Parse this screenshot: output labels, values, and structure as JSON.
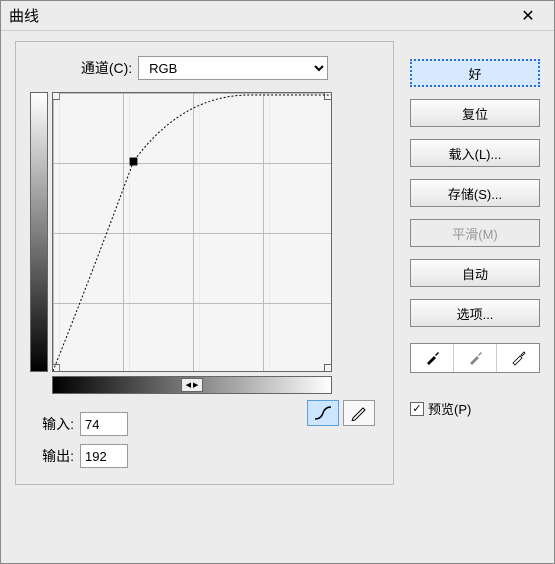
{
  "window": {
    "title": "曲线"
  },
  "channel": {
    "label": "通道(C):",
    "value": "RGB"
  },
  "io": {
    "input_label": "输入:",
    "input_value": "74",
    "output_label": "输出:",
    "output_value": "192"
  },
  "buttons": {
    "ok": "好",
    "reset": "复位",
    "load": "载入(L)...",
    "save": "存储(S)...",
    "smooth": "平滑(M)",
    "auto": "自动",
    "options": "选项..."
  },
  "preview": {
    "label": "预览(P)",
    "checked": "✓"
  },
  "chart_data": {
    "type": "line",
    "title": "",
    "xlabel": "",
    "ylabel": "",
    "xlim": [
      0,
      255
    ],
    "ylim": [
      0,
      255
    ],
    "series": [
      {
        "name": "curve",
        "points": [
          {
            "x": 0,
            "y": 0
          },
          {
            "x": 74,
            "y": 192
          },
          {
            "x": 180,
            "y": 255
          },
          {
            "x": 255,
            "y": 255
          }
        ]
      }
    ],
    "control_point": {
      "x": 74,
      "y": 192
    }
  }
}
